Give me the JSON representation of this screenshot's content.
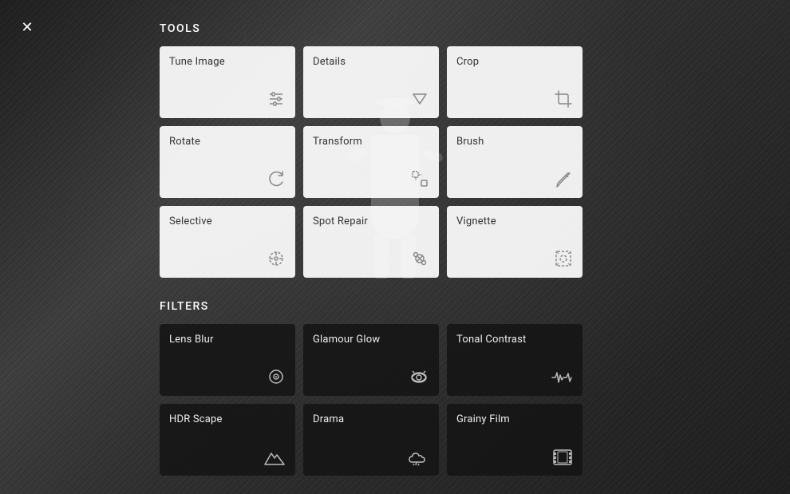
{
  "close": {
    "label": "✕"
  },
  "sections": {
    "tools_title": "TOOLS",
    "filters_title": "FILTERS"
  },
  "tools": [
    {
      "id": "tune-image",
      "label": "Tune Image",
      "icon": "sliders",
      "dark": false
    },
    {
      "id": "details",
      "label": "Details",
      "icon": "triangle-down",
      "dark": false
    },
    {
      "id": "crop",
      "label": "Crop",
      "icon": "crop",
      "dark": false
    },
    {
      "id": "rotate",
      "label": "Rotate",
      "icon": "rotate",
      "dark": false
    },
    {
      "id": "transform",
      "label": "Transform",
      "icon": "transform",
      "dark": false
    },
    {
      "id": "brush",
      "label": "Brush",
      "icon": "brush",
      "dark": false
    },
    {
      "id": "selective",
      "label": "Selective",
      "icon": "selective",
      "dark": false
    },
    {
      "id": "spot-repair",
      "label": "Spot Repair",
      "icon": "spot",
      "dark": false
    },
    {
      "id": "vignette",
      "label": "Vignette",
      "icon": "vignette",
      "dark": false
    }
  ],
  "filters": [
    {
      "id": "lens-blur",
      "label": "Lens Blur",
      "icon": "lens",
      "dark": true
    },
    {
      "id": "glamour-glow",
      "label": "Glamour Glow",
      "icon": "eye",
      "dark": true
    },
    {
      "id": "tonal-contrast",
      "label": "Tonal Contrast",
      "icon": "waveform",
      "dark": true
    },
    {
      "id": "hdr-scape",
      "label": "HDR Scape",
      "icon": "mountain",
      "dark": true
    },
    {
      "id": "drama",
      "label": "Drama",
      "icon": "cloud",
      "dark": true
    },
    {
      "id": "grainy-film",
      "label": "Grainy Film",
      "icon": "film",
      "dark": true
    }
  ]
}
